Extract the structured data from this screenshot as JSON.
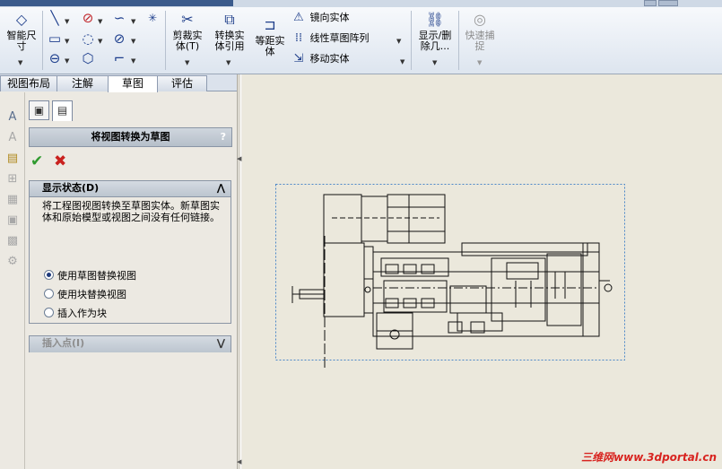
{
  "commands": {
    "smart_dimension": "智能尺寸",
    "trim_entities": "剪裁实体(T)",
    "convert_entities": "转换实体引用",
    "offset_entities": "等距实体",
    "mirror_entities": "镜向实体",
    "linear_pattern": "线性草图阵列",
    "move_entities": "移动实体",
    "show_delete": "显示/删除几...",
    "quick_snaps": "快速捕捉"
  },
  "tabs": [
    "视图布局",
    "注解",
    "草图",
    "评估"
  ],
  "active_tab": "草图",
  "property_manager": {
    "title": "将视图转换为草图",
    "help": "?",
    "ok_icon": "check-icon",
    "cancel_icon": "close-icon",
    "display_state_group": {
      "header": "显示状态(D)",
      "description": "将工程图视图转换至草图实体。新草图实体和原始模型或视图之间没有任何链接。",
      "options": [
        "使用草图替换视图",
        "使用块替换视图",
        "插入作为块"
      ],
      "selected": "使用草图替换视图"
    },
    "insert_point_group": {
      "header": "插入点(I)"
    }
  },
  "watermark": "三维网www.3dportal.cn"
}
